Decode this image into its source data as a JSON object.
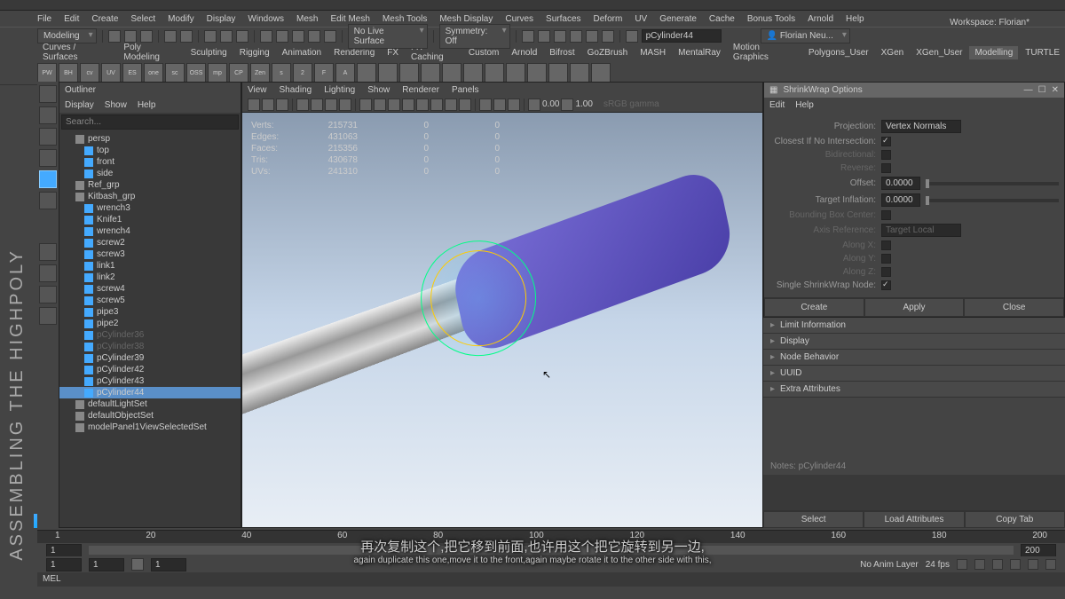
{
  "menu": {
    "file": "File",
    "edit": "Edit",
    "create": "Create",
    "select": "Select",
    "modify": "Modify",
    "display": "Display",
    "windows": "Windows",
    "mesh": "Mesh",
    "edit_mesh": "Edit Mesh",
    "mesh_tools": "Mesh Tools",
    "mesh_display": "Mesh Display",
    "curves": "Curves",
    "surfaces": "Surfaces",
    "deform": "Deform",
    "uv": "UV",
    "generate": "Generate",
    "cache": "Cache",
    "bonus_tools": "Bonus Tools",
    "arnold": "Arnold",
    "help": "Help"
  },
  "workspace": {
    "label": "Workspace:",
    "value": "Florian*"
  },
  "toolbar": {
    "mode": "Modeling",
    "live": "No Live Surface",
    "sym": "Symmetry: Off",
    "obj": "pCylinder44",
    "user": "Florian Neu..."
  },
  "shelves": [
    "Curves / Surfaces",
    "Poly Modeling",
    "Sculpting",
    "Rigging",
    "Animation",
    "Rendering",
    "FX",
    "FX Caching",
    "Custom",
    "Arnold",
    "Bifrost",
    "GoZBrush",
    "MASH",
    "MentalRay",
    "Motion Graphics",
    "Polygons_User",
    "XGen",
    "XGen_User",
    "Modelling",
    "TURTLE"
  ],
  "shelf_active": "Modelling",
  "shelf_labels": [
    "PW",
    "BH",
    "cv",
    "UV",
    "ES",
    "one",
    "sc",
    "OSS",
    "mp",
    "CP",
    "Zen",
    "s",
    "2",
    "F",
    "A"
  ],
  "outliner": {
    "title": "Outliner",
    "menu": {
      "display": "Display",
      "show": "Show",
      "help": "Help"
    },
    "search": "Search...",
    "items": [
      {
        "label": "persp",
        "lvl": 0
      },
      {
        "label": "top",
        "lvl": 1
      },
      {
        "label": "front",
        "lvl": 1
      },
      {
        "label": "side",
        "lvl": 1
      },
      {
        "label": "Ref_grp",
        "lvl": 0
      },
      {
        "label": "Kitbash_grp",
        "lvl": 0
      },
      {
        "label": "wrench3",
        "lvl": 1
      },
      {
        "label": "Knife1",
        "lvl": 1
      },
      {
        "label": "wrench4",
        "lvl": 1
      },
      {
        "label": "screw2",
        "lvl": 1
      },
      {
        "label": "screw3",
        "lvl": 1
      },
      {
        "label": "link1",
        "lvl": 1
      },
      {
        "label": "link2",
        "lvl": 1
      },
      {
        "label": "screw4",
        "lvl": 1
      },
      {
        "label": "screw5",
        "lvl": 1
      },
      {
        "label": "pipe3",
        "lvl": 1
      },
      {
        "label": "pipe2",
        "lvl": 1
      },
      {
        "label": "pCylinder36",
        "lvl": 1,
        "dim": true
      },
      {
        "label": "pCylinder38",
        "lvl": 1,
        "dim": true
      },
      {
        "label": "pCylinder39",
        "lvl": 1
      },
      {
        "label": "pCylinder42",
        "lvl": 1
      },
      {
        "label": "pCylinder43",
        "lvl": 1
      },
      {
        "label": "pCylinder44",
        "lvl": 1,
        "sel": true
      },
      {
        "label": "defaultLightSet",
        "lvl": 0
      },
      {
        "label": "defaultObjectSet",
        "lvl": 0
      },
      {
        "label": "modelPanel1ViewSelectedSet",
        "lvl": 0
      }
    ]
  },
  "viewport": {
    "menu": {
      "view": "View",
      "shading": "Shading",
      "lighting": "Lighting",
      "show": "Show",
      "renderer": "Renderer",
      "panels": "Panels"
    },
    "exp": "0.00",
    "gamma": "1.00",
    "space": "sRGB gamma"
  },
  "hud": {
    "rows": [
      {
        "label": "Verts:",
        "v1": "215731",
        "v2": "0",
        "v3": "0"
      },
      {
        "label": "Edges:",
        "v1": "431063",
        "v2": "0",
        "v3": "0"
      },
      {
        "label": "Faces:",
        "v1": "215356",
        "v2": "0",
        "v3": "0"
      },
      {
        "label": "Tris:",
        "v1": "430678",
        "v2": "0",
        "v3": "0"
      },
      {
        "label": "UVs:",
        "v1": "241310",
        "v2": "0",
        "v3": "0"
      }
    ]
  },
  "dialog": {
    "title": "ShrinkWrap Options",
    "edit": "Edit",
    "help": "Help",
    "projection_l": "Projection:",
    "projection_v": "Vertex Normals",
    "closest_l": "Closest If No Intersection:",
    "bidir_l": "Bidirectional:",
    "reverse_l": "Reverse:",
    "offset_l": "Offset:",
    "offset_v": "0.0000",
    "inflation_l": "Target Inflation:",
    "inflation_v": "0.0000",
    "bbox_l": "Bounding Box Center:",
    "axis_l": "Axis Reference:",
    "axis_v": "Target Local",
    "ax": "Along X:",
    "ay": "Along Y:",
    "az": "Along Z:",
    "single_l": "Single ShrinkWrap Node:",
    "create": "Create",
    "apply": "Apply",
    "close": "Close"
  },
  "acc": {
    "limit": "Limit Information",
    "display": "Display",
    "node": "Node Behavior",
    "uuid": "UUID",
    "extra": "Extra Attributes"
  },
  "notes": {
    "label": "Notes: pCylinder44"
  },
  "btns": {
    "select": "Select",
    "load": "Load Attributes",
    "copy": "Copy Tab"
  },
  "timeline": {
    "start": "1",
    "end": "200",
    "curr": "1",
    "anim_layer": "No Anim Layer",
    "fps": "24 fps"
  },
  "mel": "MEL",
  "sub_cn": "再次复制这个,把它移到前面,也许用这个把它旋转到另一边,",
  "sub_en": "again duplicate this one,move it to the front,again maybe rotate it to the other side with this,"
}
